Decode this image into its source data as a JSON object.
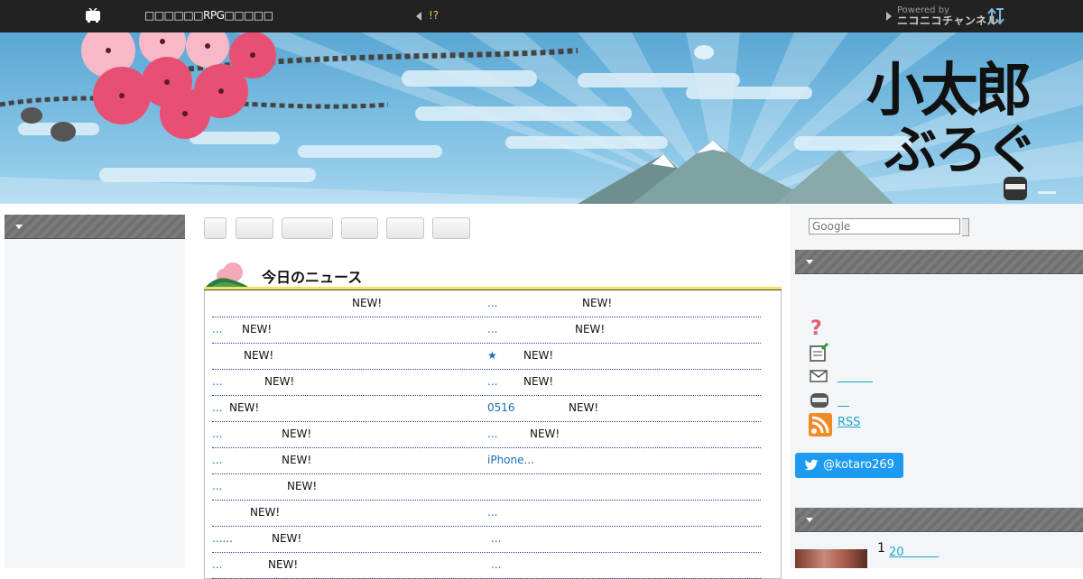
{
  "topbar": {
    "channel_title": "□□□□□□RPG□□□□□",
    "alert_text": "!?",
    "powered_by": "Powered by",
    "brand": "ニコニコチャンネル"
  },
  "banner": {
    "logo_line1": "小太郎",
    "logo_line2": "ぶろぐ"
  },
  "main": {
    "tabs": [
      "",
      "",
      "",
      "",
      "",
      ""
    ],
    "news_title": "今日のニュース",
    "news_rows": [
      {
        "left_link": "",
        "left_new": "NEW!",
        "right_link": "...",
        "right_new": "NEW!"
      },
      {
        "left_link": "...",
        "left_new": "NEW!",
        "right_link": "...",
        "right_new": "NEW!"
      },
      {
        "left_link": "",
        "left_new": "NEW!",
        "right_link": "★",
        "right_new": "NEW!"
      },
      {
        "left_link": "...",
        "left_new": "NEW!",
        "right_link": "...",
        "right_new": "NEW!"
      },
      {
        "left_link": "...",
        "left_new": "NEW!",
        "right_link": "0516",
        "right_new": "NEW!"
      },
      {
        "left_link": "...",
        "left_new": "NEW!",
        "right_link": "...",
        "right_new": "NEW!"
      },
      {
        "left_link": "...",
        "left_new": "NEW!",
        "right_link": "iPhone...",
        "right_new": ""
      },
      {
        "left_link": "...",
        "left_new": "NEW!",
        "right_link": "",
        "right_new": ""
      },
      {
        "left_link": "",
        "left_new": "NEW!",
        "right_link": "...",
        "right_new": ""
      },
      {
        "left_link": "......",
        "left_new": "NEW!",
        "right_link": "...",
        "right_new": ""
      },
      {
        "left_link": "...",
        "left_new": "NEW!",
        "right_link": "...",
        "right_new": ""
      }
    ]
  },
  "right_sidebar": {
    "search_placeholder": "Google",
    "links": [
      {
        "icon": "question-icon",
        "label": ""
      },
      {
        "icon": "note-icon",
        "label": ""
      },
      {
        "icon": "mail-icon",
        "label": "＿＿＿"
      },
      {
        "icon": "ninja-icon",
        "label": "＿"
      },
      {
        "icon": "rss-icon",
        "label": "RSS"
      }
    ],
    "twitter_handle": "@kotaro269",
    "ranking": {
      "number": "1",
      "link": "20＿＿＿"
    }
  },
  "colors": {
    "topbar": "#222222",
    "accent_link": "#1a6fb3",
    "sidebar_link": "#23a4c8",
    "twitter": "#1d9bf0"
  }
}
